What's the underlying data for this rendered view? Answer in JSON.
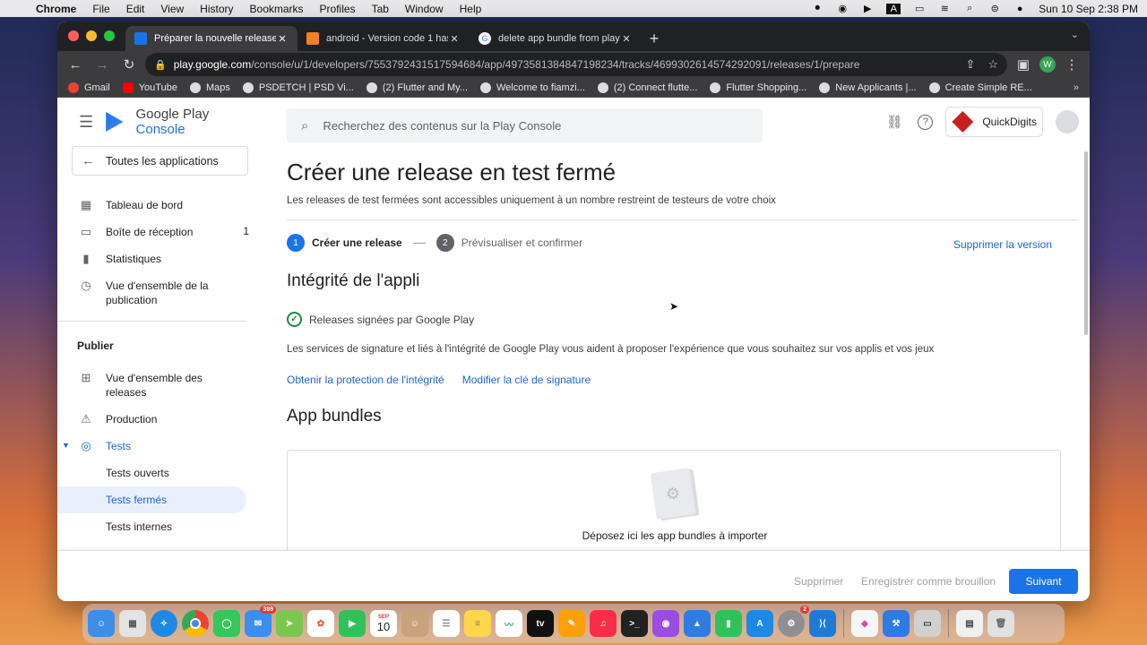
{
  "menubar": {
    "app": "Chrome",
    "items": [
      "File",
      "Edit",
      "View",
      "History",
      "Bookmarks",
      "Profiles",
      "Tab",
      "Window",
      "Help"
    ],
    "datetime": "Sun 10 Sep  2:38 PM",
    "input_source": "A"
  },
  "browser": {
    "tabs": [
      {
        "title": "Préparer la nouvelle release | G",
        "color": "#1a73e8"
      },
      {
        "title": "android - Version code 1 has al",
        "color": "#f48024"
      },
      {
        "title": "delete app bundle from play st",
        "color": "#ffffff"
      }
    ],
    "url_host": "play.google.com",
    "url_path": "/console/u/1/developers/7553792431517594684/app/4973581384847198234/tracks/4699302614574292091/releases/1/prepare",
    "profile_initial": "W",
    "bookmarks": [
      {
        "label": "Gmail",
        "color": "#ea4335"
      },
      {
        "label": "YouTube",
        "color": "#ff0000"
      },
      {
        "label": "Maps",
        "color": "#dddddd"
      },
      {
        "label": "PSDETCH | PSD Vi...",
        "color": "#dddddd"
      },
      {
        "label": "(2) Flutter and My...",
        "color": "#dddddd"
      },
      {
        "label": "Welcome to fiamzi...",
        "color": "#dddddd"
      },
      {
        "label": "(2) Connect flutte...",
        "color": "#dddddd"
      },
      {
        "label": "Flutter Shopping...",
        "color": "#dddddd"
      },
      {
        "label": "New Applicants |...",
        "color": "#dddddd"
      },
      {
        "label": "Create Simple RE...",
        "color": "#dddddd"
      }
    ],
    "bookmarks_more": "»"
  },
  "console": {
    "brand_google": "Google Play",
    "brand_console": "Console",
    "all_apps": "Toutes les applications",
    "nav": {
      "dashboard": "Tableau de bord",
      "inbox": "Boîte de réception",
      "inbox_count": "1",
      "stats": "Statistiques",
      "publishing_overview": "Vue d'ensemble de la publication",
      "section_publish": "Publier",
      "releases_overview": "Vue d'ensemble des releases",
      "production": "Production",
      "tests": "Tests",
      "open_tests": "Tests ouverts",
      "closed_tests": "Tests fermés",
      "internal_tests": "Tests internes"
    },
    "search_placeholder": "Recherchez des contenus sur la Play Console",
    "app_name": "QuickDigits",
    "title": "Créer une release en test fermé",
    "subtitle": "Les releases de test fermées sont accessibles uniquement à un nombre restreint de testeurs de votre choix",
    "steps": [
      {
        "num": "1",
        "label": "Créer une release",
        "active": true
      },
      {
        "num": "2",
        "label": "Prévisualiser et confirmer",
        "active": false
      }
    ],
    "delete_version": "Supprimer la version",
    "integrity_title": "Intégrité de l'appli",
    "signed_status": "Releases signées par Google Play",
    "integrity_desc": "Les services de signature et liés à l'intégrité de Google Play vous aident à proposer l'expérience que vous souhaitez sur vos applis et vos jeux",
    "link_protect": "Obtenir la protection de l'intégrité",
    "link_change_key": "Modifier la clé de signature",
    "bundles_title": "App bundles",
    "drop_text": "Déposez ici les app bundles à importer",
    "footer": {
      "delete": "Supprimer",
      "save_draft": "Enregistrer comme brouillon",
      "next": "Suivant"
    }
  },
  "dock": {
    "calendar_month": "SEP",
    "calendar_day": "10",
    "mail_badge": "389",
    "settings_badge": "2",
    "apps": [
      {
        "name": "finder-icon",
        "color": "#3d8ee8"
      },
      {
        "name": "launchpad-icon",
        "color": "#e3e3e3"
      },
      {
        "name": "safari-icon",
        "color": "#1e88e5"
      },
      {
        "name": "chrome-icon",
        "color": "#ffffff"
      },
      {
        "name": "messages-icon",
        "color": "#34c759"
      },
      {
        "name": "mail-icon",
        "color": "#3a8ff0"
      },
      {
        "name": "maps-icon",
        "color": "#7ac74f"
      },
      {
        "name": "photos-icon",
        "color": "#ffffff"
      },
      {
        "name": "facetime-icon",
        "color": "#30c25a"
      },
      {
        "name": "calendar-icon",
        "color": "#ffffff"
      },
      {
        "name": "contacts-icon",
        "color": "#c8a27a"
      },
      {
        "name": "reminders-icon",
        "color": "#ffffff"
      },
      {
        "name": "notes-icon",
        "color": "#ffd54a"
      },
      {
        "name": "freeform-icon",
        "color": "#ffffff"
      },
      {
        "name": "appletv-icon",
        "color": "#111111"
      },
      {
        "name": "pages-icon",
        "color": "#ff9f0a"
      },
      {
        "name": "music-icon",
        "color": "#fa2d48"
      },
      {
        "name": "terminal-icon",
        "color": "#222222"
      },
      {
        "name": "podcasts-icon",
        "color": "#9b4de0"
      },
      {
        "name": "keynote-icon",
        "color": "#2f7de1"
      },
      {
        "name": "numbers-icon",
        "color": "#30c25a"
      },
      {
        "name": "appstore-icon",
        "color": "#1e88e5"
      },
      {
        "name": "settings-icon",
        "color": "#8e8e93"
      },
      {
        "name": "vscode-icon",
        "color": "#1f7ad6"
      }
    ],
    "extra": [
      {
        "name": "color-picker-icon",
        "color": "#f5f5f5"
      },
      {
        "name": "xcode-icon",
        "color": "#2d7be5"
      },
      {
        "name": "simulator-icon",
        "color": "#d0d0d0"
      },
      {
        "name": "preview-icon",
        "color": "#f0f0f0"
      },
      {
        "name": "trash-icon",
        "color": "#e0e0e0"
      }
    ]
  }
}
